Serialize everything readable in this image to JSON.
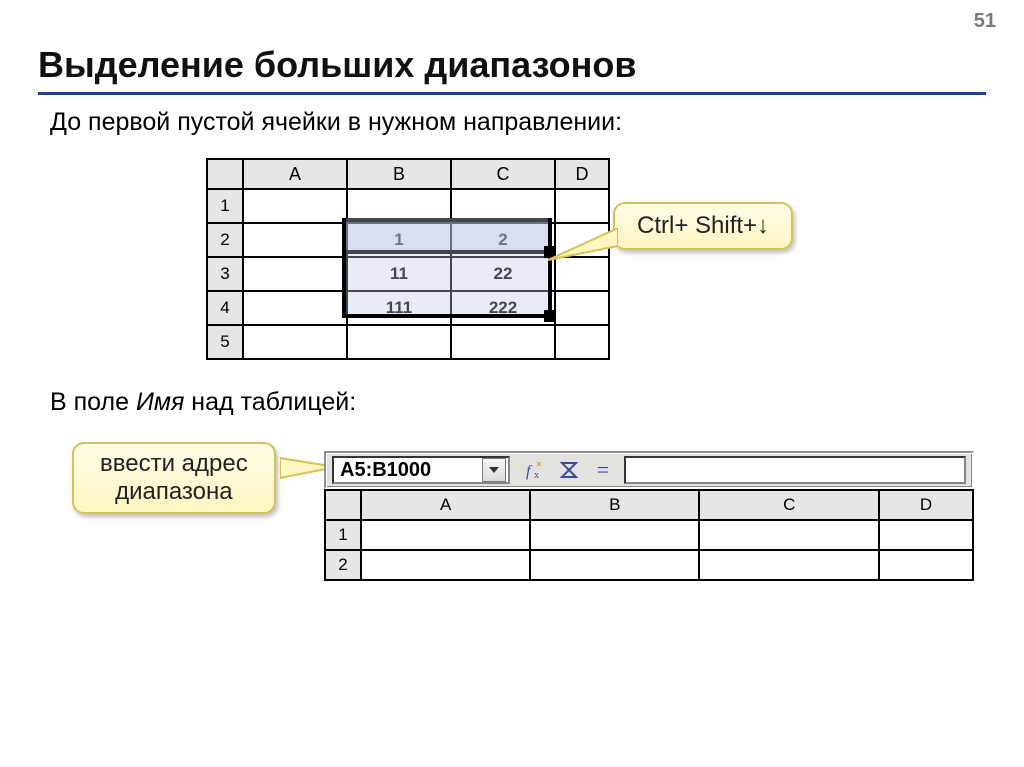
{
  "page_number": "51",
  "title": "Выделение больших диапазонов",
  "subtitle_1": "До первой пустой ячейки в нужном направлении:",
  "subtitle_2_pre": "В поле ",
  "subtitle_2_em": "Имя",
  "subtitle_2_post": " над таблицей:",
  "sheet1": {
    "cols": [
      "A",
      "B",
      "C",
      "D"
    ],
    "rows": [
      "1",
      "2",
      "3",
      "4",
      "5"
    ],
    "cells": {
      "B2": "1",
      "C2": "2",
      "B3": "11",
      "C3": "22",
      "B4": "111",
      "C4": "222"
    }
  },
  "callout_shortcut": "Ctrl+ Shift+↓",
  "callout_namebox_line1": "ввести адрес",
  "callout_namebox_line2": "диапазона",
  "namebox_value": "A5:B1000",
  "equals_sign": "=",
  "sheet2": {
    "cols": [
      "A",
      "B",
      "C",
      "D"
    ],
    "rows": [
      "1",
      "2"
    ]
  }
}
